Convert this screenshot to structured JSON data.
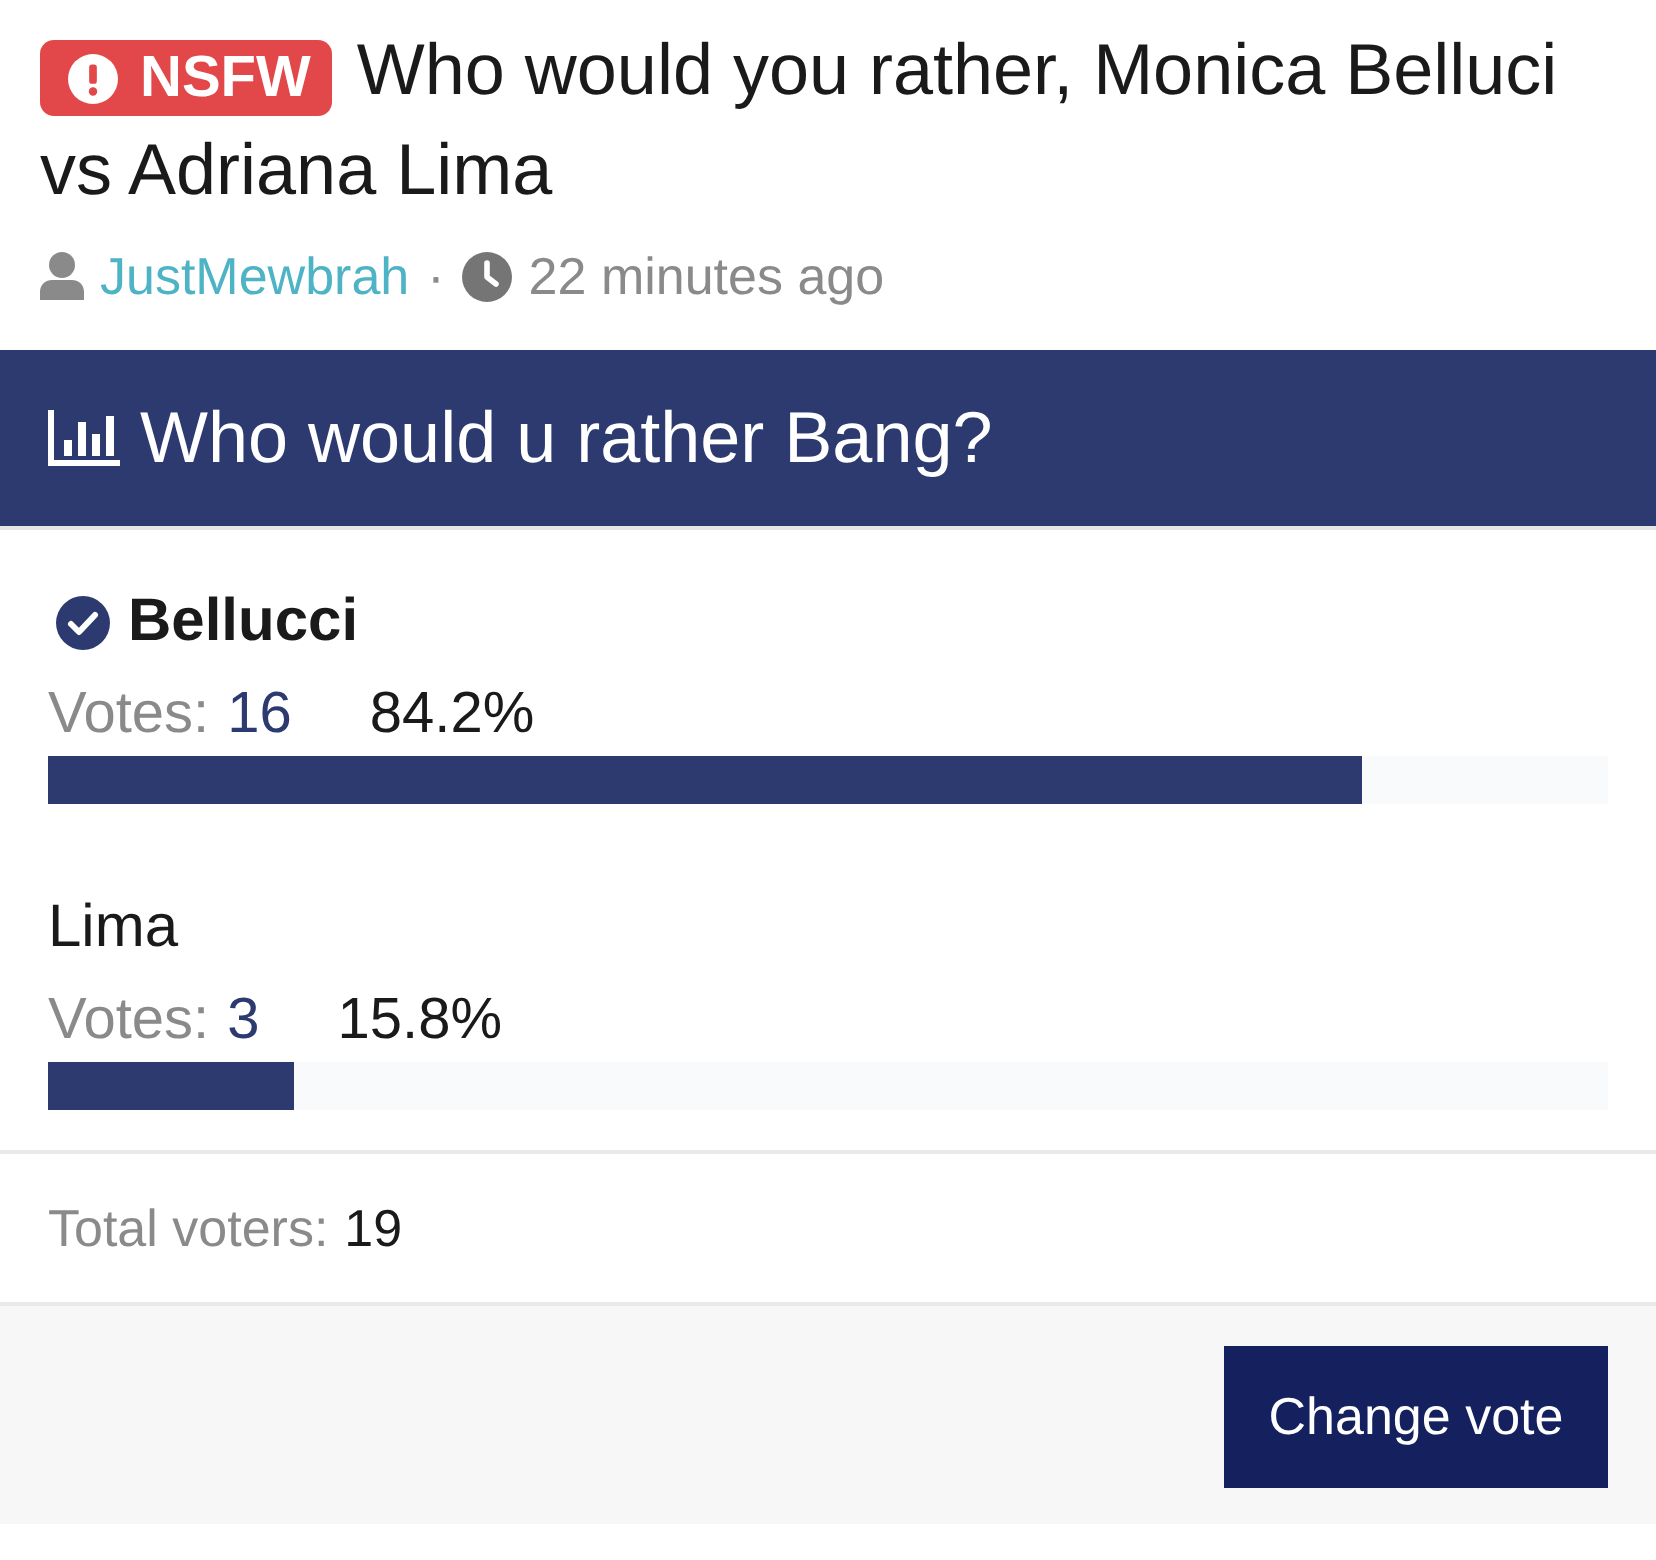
{
  "post": {
    "badge": "NSFW",
    "title": "Who would you rather, Monica Belluci vs Adriana Lima",
    "author": "JustMewbrah",
    "separator": "·",
    "time": "22 minutes ago"
  },
  "poll": {
    "question": "Who would u rather Bang?",
    "options": [
      {
        "name": "Bellucci",
        "selected": true,
        "votes_label": "Votes:",
        "votes": "16",
        "percent": "84.2%",
        "level": 0.842
      },
      {
        "name": "Lima",
        "selected": false,
        "votes_label": "Votes:",
        "votes": "3",
        "percent": "15.8%",
        "level": 0.158
      }
    ],
    "total_label": "Total voters:",
    "total": "19",
    "button": "Change vote"
  }
}
